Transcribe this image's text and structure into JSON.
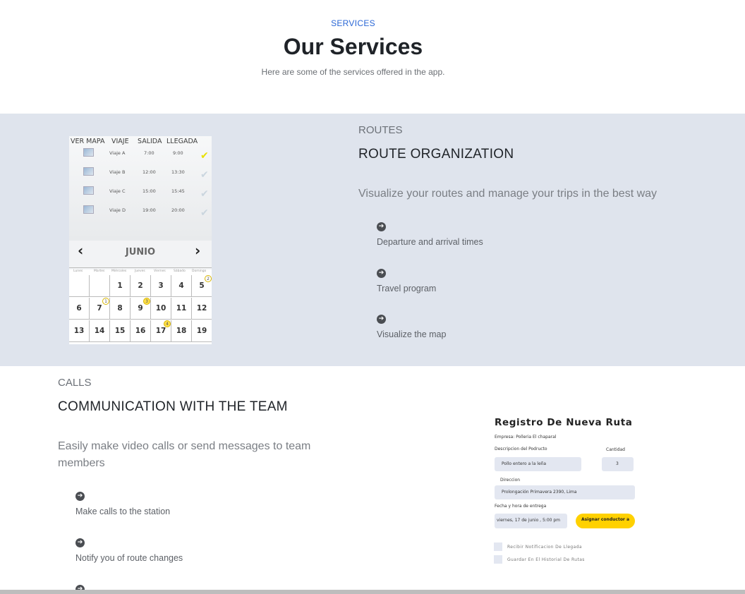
{
  "header": {
    "eyebrow": "SERVICES",
    "title": "Our Services",
    "subtitle": "Here are some of the services offered in the app."
  },
  "routes": {
    "kicker": "ROUTES",
    "title": "ROUTE ORGANIZATION",
    "lead": "Visualize your routes and manage your trips in the best way",
    "features": [
      "Departure and arrival times",
      "Travel program",
      "Visualize the map"
    ],
    "schedule_image": {
      "headers": [
        "VER MAPA",
        "VIAJE",
        "SALIDA",
        "LLEGADA"
      ],
      "rows": [
        {
          "trip": "Viaje A",
          "dep": "7:00",
          "arr": "9:00",
          "checked": true
        },
        {
          "trip": "Viaje B",
          "dep": "12:00",
          "arr": "13:30",
          "checked": false
        },
        {
          "trip": "Viaje C",
          "dep": "15:00",
          "arr": "15:45",
          "checked": false
        },
        {
          "trip": "Viaje D",
          "dep": "19:00",
          "arr": "20:00",
          "checked": false
        }
      ],
      "month": "JUNIO",
      "weekdays": [
        "Lunes",
        "Martes",
        "Miércoles",
        "Jueves",
        "Viernes",
        "Sábado",
        "Domingo"
      ],
      "weeks": [
        [
          "",
          "",
          "1",
          "2",
          "3",
          "4",
          "5"
        ],
        [
          "6",
          "7",
          "8",
          "9",
          "10",
          "11",
          "12"
        ],
        [
          "13",
          "14",
          "15",
          "16",
          "17",
          "18",
          "19"
        ]
      ],
      "badges": [
        {
          "day": "5",
          "n": "2",
          "style": "ring"
        },
        {
          "day": "7",
          "n": "1",
          "style": "ring"
        },
        {
          "day": "9",
          "n": "3",
          "style": "fill"
        },
        {
          "day": "17",
          "n": "4",
          "style": "fill"
        }
      ]
    }
  },
  "calls": {
    "kicker": "CALLS",
    "title": "COMMUNICATION WITH THE TEAM",
    "lead": "Easily make video calls or send messages to team members",
    "features": [
      "Make calls to the station",
      "Notify you of route changes"
    ]
  },
  "form_image": {
    "title": "Registro De Nueva Ruta",
    "company": "Empresa: Polleria El chaparal",
    "product_label": "Descripcion del Podructo",
    "qty_label": "Cantidad",
    "product_value": "Pollo entero a la leña",
    "qty_value": "3",
    "address_label": "Direccion",
    "address_value": "Prolongación Primavera 2390, Lima",
    "date_label": "Fecha y hora  de entrega",
    "date_value": "viernes, 17 de junio , 5:00 pm",
    "button": "Asignar conductor a",
    "check1": "Recibir Notificacion De Llegada",
    "check2": "Guardar En El Historial De Rutas"
  },
  "icons": {
    "feature": "arrow-right-circle-icon",
    "check": "checkmark-icon",
    "map": "map-icon"
  },
  "colors": {
    "accent": "#2a67d6",
    "section_bg": "#dfe4ed",
    "button": "#ffd100"
  }
}
